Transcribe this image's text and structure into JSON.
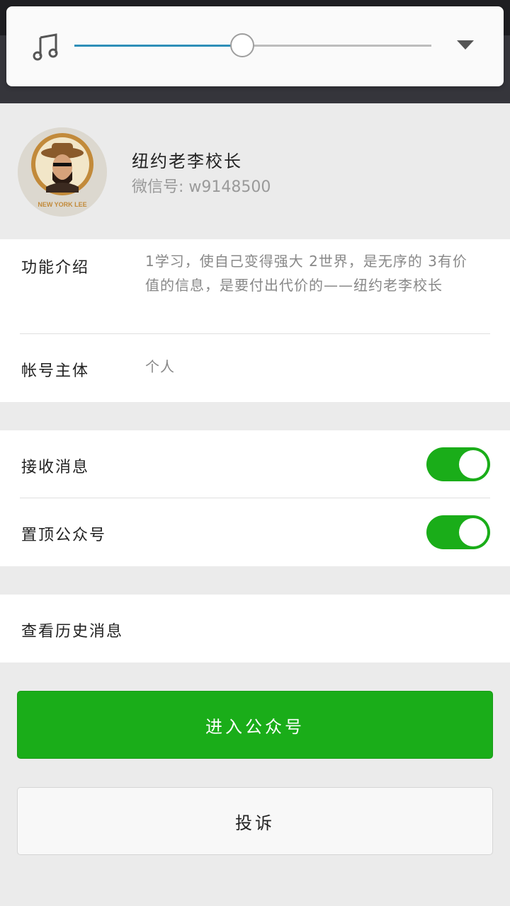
{
  "app_bar": {
    "back_icon": "arrow-left-icon",
    "more_icon": "more-vertical-icon"
  },
  "volume": {
    "icon": "music-note-icon",
    "level": 0.47,
    "accent": "#2e8fb8",
    "expand_icon": "triangle-down-icon"
  },
  "profile": {
    "name": "纽约老李校长",
    "wechat_id": "微信号: w9148500",
    "avatar_text": "NEW YORK LEE"
  },
  "info": {
    "intro_label": "功能介绍",
    "intro_value": "1学习，使自己变得强大 2世界，是无序的 3有价值的信息，是要付出代价的——纽约老李校长",
    "account_label": "帐号主体",
    "account_value": "个人"
  },
  "settings": {
    "receive_label": "接收消息",
    "receive_on": true,
    "pin_label": "置顶公众号",
    "pin_on": true
  },
  "history": {
    "label": "查看历史消息"
  },
  "buttons": {
    "enter_label": "进入公众号",
    "complain_label": "投诉"
  },
  "colors": {
    "brand_green": "#1aad19"
  }
}
